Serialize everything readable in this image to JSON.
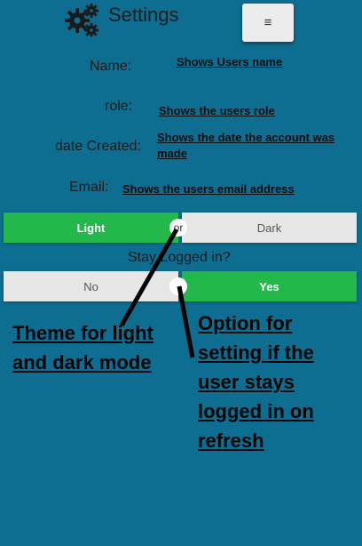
{
  "theme": {
    "background": "#0e6e91",
    "on_color": "#22b84a",
    "off_color": "#e6e6e6"
  },
  "header": {
    "title": "Settings",
    "icon": "gears-icon",
    "menu_icon": "≡"
  },
  "profile": {
    "name_label": "Name:",
    "name_value": "Shows Users name",
    "role_label": "role:",
    "role_value": "Shows the users role",
    "date_label": "date Created:",
    "date_value": "Shows the date the account was made",
    "email_label": "Email:",
    "email_value": "Shows the users email address"
  },
  "theme_toggle": {
    "left": "Light",
    "or": "or",
    "right": "Dark",
    "selected": "Light"
  },
  "stay_logged": {
    "label": "Stay Logged in?",
    "left": "No",
    "right": "Yes",
    "selected": "Yes"
  },
  "annotations": {
    "theme_note": "Theme for light and dark mode",
    "logged_note": "Option for setting if the user stays logged in on refresh"
  }
}
